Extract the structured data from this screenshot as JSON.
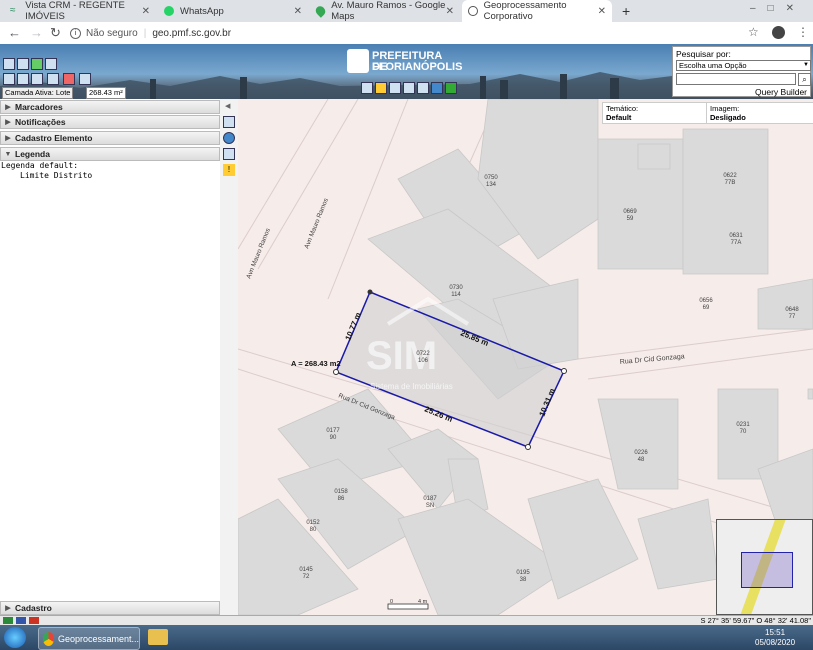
{
  "browser": {
    "tabs": [
      {
        "label": "Vista CRM - REGENTE IMÓVEIS",
        "icon": "crm-icon"
      },
      {
        "label": "WhatsApp",
        "icon": "whatsapp-icon"
      },
      {
        "label": "Av. Mauro Ramos - Google Maps",
        "icon": "maps-icon"
      },
      {
        "label": "Geoprocessamento Corporativo",
        "icon": "globe-icon"
      }
    ],
    "new_tab": "+",
    "security": "Não seguro",
    "url": "geo.pmf.sc.gov.br"
  },
  "header": {
    "logo_line1": "PREFEITURA DE",
    "logo_line2": "FLORIANÓPOLIS",
    "search_label": "Pesquisar por:",
    "search_select": "Escolha uma Opção",
    "query_builder": "Query Builder",
    "active_layer_label": "Camada Ativa: Lote",
    "active_layer_area": "268.43 m²"
  },
  "sidebar": {
    "sections": [
      {
        "label": "Marcadores",
        "open": false
      },
      {
        "label": "Notificações",
        "open": false
      },
      {
        "label": "Cadastro Elemento",
        "open": false
      },
      {
        "label": "Legenda",
        "open": true
      }
    ],
    "legend_default": "Legenda default:",
    "legend_item": "Limite Distrito",
    "bottom_section": "Cadastro"
  },
  "map": {
    "tematico_label": "Temático:",
    "tematico_value": "Default",
    "imagem_label": "Imagem:",
    "imagem_value": "Desligado",
    "area_label": "A = 268.43 m2",
    "measure_top": "25.85 m",
    "measure_bottom": "25.26 m",
    "measure_left": "10.77 m",
    "measure_right": "10.31 m",
    "street_gonzaga_right": "Rua Dr Cid Gonzaga",
    "street_gonzaga_left": "Rua Dr Cid Gonzaga",
    "street_mauro_ramos_1": "Avn Mauro Ramos",
    "street_mauro_ramos_2": "Avn Mauro Ramos",
    "watermark": "SIM",
    "watermark_sub": "Sistema de Imobiliárias",
    "lots": [
      {
        "code": "0750",
        "num": "134"
      },
      {
        "code": "0730",
        "num": "114"
      },
      {
        "code": "0722",
        "num": "106"
      },
      {
        "code": "0669",
        "num": "59"
      },
      {
        "code": "0622",
        "num": "77B"
      },
      {
        "code": "0631",
        "num": "77A"
      },
      {
        "code": "0656",
        "num": "69"
      },
      {
        "code": "0648",
        "num": "77"
      },
      {
        "code": "0177",
        "num": "90"
      },
      {
        "code": "0158",
        "num": "86"
      },
      {
        "code": "0187",
        "num": "SN"
      },
      {
        "code": "0152",
        "num": "80"
      },
      {
        "code": "0145",
        "num": "72"
      },
      {
        "code": "0195",
        "num": "38"
      },
      {
        "code": "0226",
        "num": "48"
      },
      {
        "code": "0231",
        "num": "70"
      }
    ],
    "scale_label": "4 m",
    "scale_zero": "0"
  },
  "status": {
    "coords": "S 27° 35' 59.67\" O 48° 32' 41.08\""
  },
  "taskbar": {
    "app_label": "Geoprocessament...",
    "time": "15:51",
    "date": "05/08/2020"
  },
  "colors": {
    "polygon": "#1a1aa8",
    "building": "#dadada",
    "street": "#f6ecea"
  }
}
